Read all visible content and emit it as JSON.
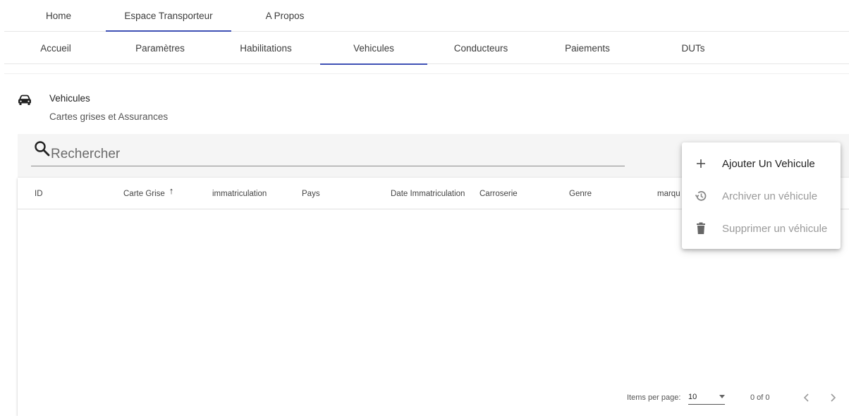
{
  "topnav": {
    "tabs": [
      {
        "label": "Home"
      },
      {
        "label": "Espace Transporteur"
      },
      {
        "label": "A Propos"
      }
    ]
  },
  "subnav": {
    "tabs": [
      {
        "label": "Accueil"
      },
      {
        "label": "Paramètres"
      },
      {
        "label": "Habilitations"
      },
      {
        "label": "Vehicules"
      },
      {
        "label": "Conducteurs"
      },
      {
        "label": "Paiements"
      },
      {
        "label": "DUTs"
      }
    ]
  },
  "section": {
    "icon": "car-icon",
    "title": "Vehicules",
    "subtitle": "Cartes grises et Assurances"
  },
  "search": {
    "placeholder": "Rechercher",
    "icon": "search-icon"
  },
  "table": {
    "columns": [
      {
        "label": "ID"
      },
      {
        "label": "Carte Grise",
        "sort": "↑"
      },
      {
        "label": "immatriculation"
      },
      {
        "label": "Pays"
      },
      {
        "label": "Date Immatriculation"
      },
      {
        "label": "Carroserie"
      },
      {
        "label": "Genre"
      },
      {
        "label": "marqu"
      }
    ]
  },
  "paginator": {
    "items_label": "Items per page:",
    "page_size": "10",
    "range": "0 of 0",
    "prev": "‹",
    "next": "›"
  },
  "menu": {
    "items": [
      {
        "label": "Ajouter Un Vehicule",
        "icon": "plus-icon",
        "enabled": true
      },
      {
        "label": "Archiver un véhicule",
        "icon": "history-icon",
        "enabled": false
      },
      {
        "label": "Supprimer un véhicule",
        "icon": "trash-icon",
        "enabled": false
      }
    ]
  },
  "colors": {
    "accent": "#3f51b5",
    "disabled_text": "#9a9a9a"
  }
}
